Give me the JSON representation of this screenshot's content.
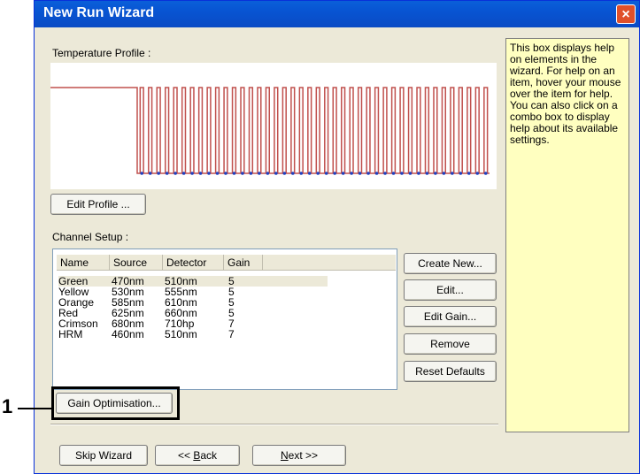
{
  "window": {
    "title": "New Run Wizard",
    "close_glyph": "×"
  },
  "temperature_profile": {
    "label": "Temperature Profile :",
    "cycles": 42,
    "line_color": "#c0504d",
    "dot_color": "#1f3fbf"
  },
  "buttons": {
    "edit_profile": "Edit Profile ...",
    "create_new": "Create New...",
    "edit": "Edit...",
    "edit_gain": "Edit Gain...",
    "remove": "Remove",
    "reset_defaults": "Reset Defaults",
    "gain_optimisation": "Gain Optimisation...",
    "skip_wizard": "Skip Wizard",
    "back_prefix": "<< ",
    "back_key": "B",
    "back_rest": "ack",
    "next_key": "N",
    "next_rest": "ext >>"
  },
  "channel_setup": {
    "label": "Channel Setup :",
    "columns": [
      "Name",
      "Source",
      "Detector",
      "Gain"
    ],
    "rows": [
      [
        "Green",
        "470nm",
        "510nm",
        "5"
      ],
      [
        "Yellow",
        "530nm",
        "555nm",
        "5"
      ],
      [
        "Orange",
        "585nm",
        "610nm",
        "5"
      ],
      [
        "Red",
        "625nm",
        "660nm",
        "5"
      ],
      [
        "Crimson",
        "680nm",
        "710hp",
        "7"
      ],
      [
        "HRM",
        "460nm",
        "510nm",
        "7"
      ]
    ]
  },
  "help_text": "This box displays help on elements in the wizard. For help on an item, hover your mouse over the item for help. You can also click on a combo box to display help about its available settings.",
  "callout": {
    "number": "1"
  }
}
